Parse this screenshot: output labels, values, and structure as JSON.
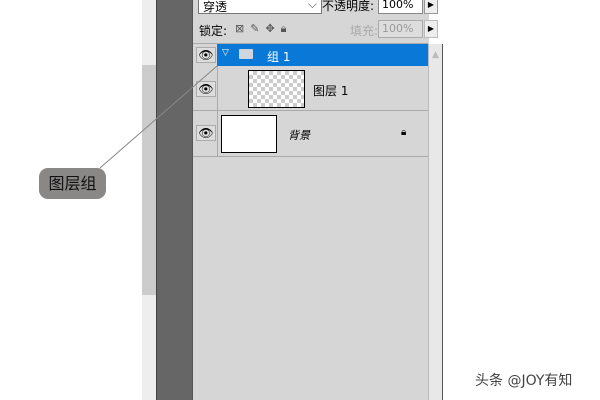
{
  "panel": {
    "blend_mode": "穿透",
    "opacity_label": "不透明度:",
    "opacity_value": "100%",
    "lock_label": "锁定:",
    "fill_label": "填充:",
    "fill_value": "100%",
    "layers": [
      {
        "name": "组 1",
        "type": "group",
        "selected": true
      },
      {
        "name": "图层 1",
        "type": "layer"
      },
      {
        "name": "背景",
        "type": "background",
        "locked": true
      }
    ]
  },
  "callout": "图层组",
  "watermark": "头条 @JOY有知"
}
